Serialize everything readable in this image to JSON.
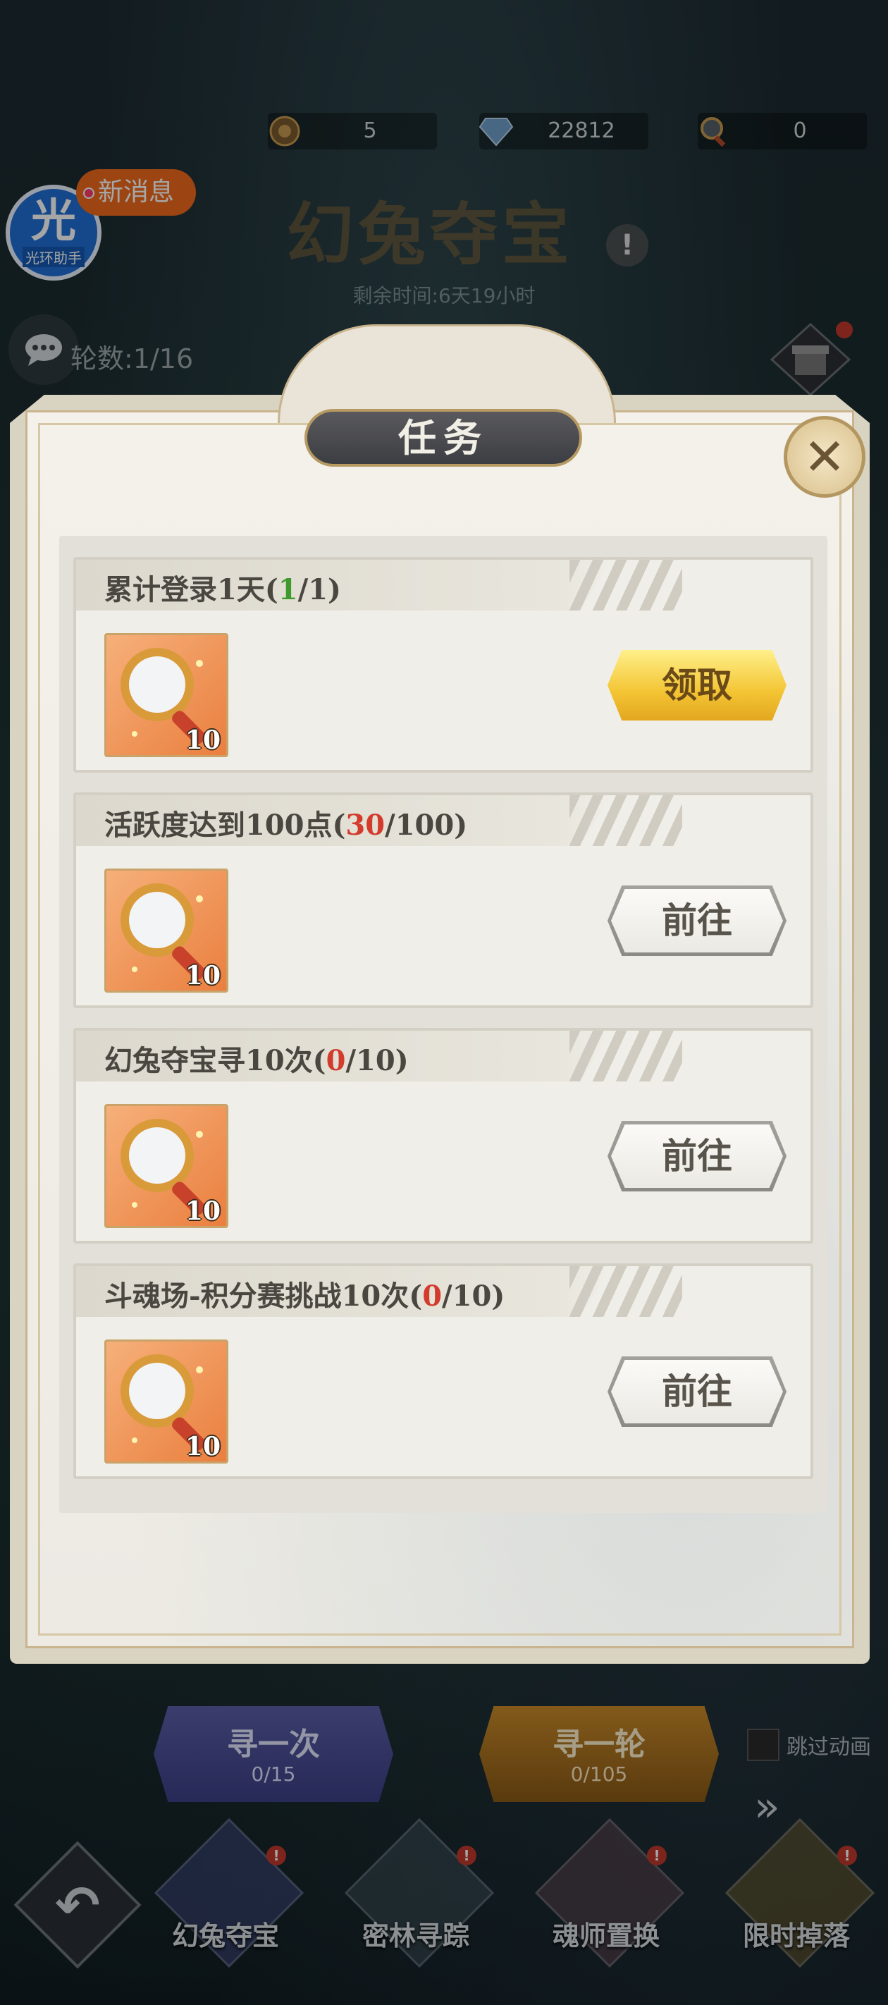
{
  "resources": [
    {
      "icon": "coin-icon",
      "value": "5"
    },
    {
      "icon": "diamond-icon",
      "value": "22812"
    },
    {
      "icon": "magnifier-key-icon",
      "value": "0"
    }
  ],
  "event": {
    "title": "幻兔夺宝",
    "time_left": "剩余时间:6天19小时",
    "rounds": "轮数:1/16"
  },
  "helper": {
    "badge": "新消息",
    "logo_char": "光",
    "logo_label": "光环助手"
  },
  "modal": {
    "title": "任务",
    "tasks": [
      {
        "title_prefix": "累计登录1天(",
        "current": "1",
        "total_suffix": "/1)",
        "current_color": "green",
        "reward_count": "10",
        "action": "领取",
        "action_type": "claim"
      },
      {
        "title_prefix": "活跃度达到100点(",
        "current": "30",
        "total_suffix": "/100)",
        "current_color": "red",
        "reward_count": "10",
        "action": "前往",
        "action_type": "go"
      },
      {
        "title_prefix": "幻兔夺宝寻10次(",
        "current": "0",
        "total_suffix": "/10)",
        "current_color": "red",
        "reward_count": "10",
        "action": "前往",
        "action_type": "go"
      },
      {
        "title_prefix": "斗魂场-积分赛挑战10次(",
        "current": "0",
        "total_suffix": "/10)",
        "current_color": "red",
        "reward_count": "10",
        "action": "前往",
        "action_type": "go"
      }
    ]
  },
  "bottom": {
    "search_once": {
      "label": "寻一次",
      "count": "0/15"
    },
    "search_round": {
      "label": "寻一轮",
      "count": "0/105"
    },
    "skip_animation": "跳过动画"
  },
  "nav": [
    {
      "label": "幻兔夺宝",
      "badge": "!"
    },
    {
      "label": "密林寻踪",
      "badge": "!"
    },
    {
      "label": "魂师置换",
      "badge": "!"
    },
    {
      "label": "限时掉落",
      "badge": "!"
    }
  ],
  "colors": {
    "accent_gold": "#f3c433",
    "progress_green": "#3f9a2e",
    "progress_red": "#d33b2c"
  }
}
